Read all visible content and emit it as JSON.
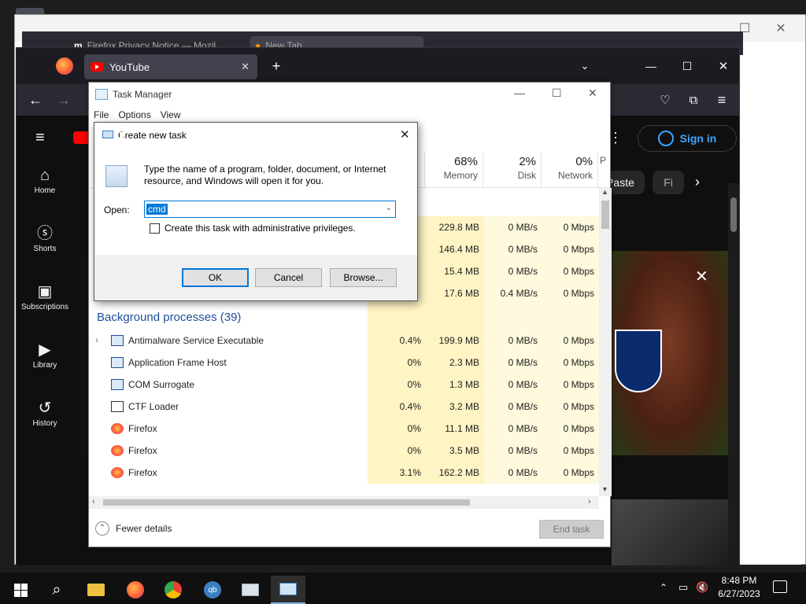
{
  "bg_firefox": {
    "tab1": "Firefox Privacy Notice — Mozil",
    "tab2": "New Tab"
  },
  "firefox": {
    "tab_title": "YouTube",
    "new_tab": "+",
    "menu": "≡"
  },
  "youtube": {
    "sidebar": [
      {
        "icon": "home-icon",
        "label": "Home"
      },
      {
        "icon": "shorts-icon",
        "label": "Shorts"
      },
      {
        "icon": "subscriptions-icon",
        "label": "Subscriptions"
      },
      {
        "icon": "library-icon",
        "label": "Library"
      },
      {
        "icon": "history-icon",
        "label": "History"
      }
    ],
    "sign_in": "Sign in",
    "chip1": "Paste",
    "chip2": "Fi",
    "close_ad": "✕"
  },
  "task_manager": {
    "title": "Task Manager",
    "menu": [
      "File",
      "Options",
      "View"
    ],
    "columns": [
      {
        "pct": "68%",
        "name": "Memory"
      },
      {
        "pct": "2%",
        "name": "Disk"
      },
      {
        "pct": "0%",
        "name": "Network"
      },
      {
        "pct": "",
        "name": "P"
      }
    ],
    "app_rows": [
      {
        "cpu": "",
        "mem": "229.8 MB",
        "disk": "0 MB/s",
        "net": "0 Mbps"
      },
      {
        "cpu": "",
        "mem": "146.4 MB",
        "disk": "0 MB/s",
        "net": "0 Mbps"
      },
      {
        "cpu": "",
        "mem": "15.4 MB",
        "disk": "0 MB/s",
        "net": "0 Mbps"
      },
      {
        "cpu": "",
        "mem": "17.6 MB",
        "disk": "0.4 MB/s",
        "net": "0 Mbps"
      }
    ],
    "bg_section": "Background processes (39)",
    "processes": [
      {
        "name": "Antimalware Service Executable",
        "cpu": "0.4%",
        "mem": "199.9 MB",
        "disk": "0 MB/s",
        "net": "0 Mbps",
        "expand": true
      },
      {
        "name": "Application Frame Host",
        "cpu": "0%",
        "mem": "2.3 MB",
        "disk": "0 MB/s",
        "net": "0 Mbps"
      },
      {
        "name": "COM Surrogate",
        "cpu": "0%",
        "mem": "1.3 MB",
        "disk": "0 MB/s",
        "net": "0 Mbps"
      },
      {
        "name": "CTF Loader",
        "cpu": "0.4%",
        "mem": "3.2 MB",
        "disk": "0 MB/s",
        "net": "0 Mbps"
      },
      {
        "name": "Firefox",
        "cpu": "0%",
        "mem": "11.1 MB",
        "disk": "0 MB/s",
        "net": "0 Mbps"
      },
      {
        "name": "Firefox",
        "cpu": "0%",
        "mem": "3.5 MB",
        "disk": "0 MB/s",
        "net": "0 Mbps"
      },
      {
        "name": "Firefox",
        "cpu": "3.1%",
        "mem": "162.2 MB",
        "disk": "0 MB/s",
        "net": "0 Mbps"
      }
    ],
    "fewer_details": "Fewer details",
    "end_task": "End task"
  },
  "run_dialog": {
    "title": "Create new task",
    "description": "Type the name of a program, folder, document, or Internet resource, and Windows will open it for you.",
    "open_label": "Open:",
    "open_value": "cmd",
    "admin_checkbox": "Create this task with administrative privileges.",
    "ok": "OK",
    "cancel": "Cancel",
    "browse": "Browse..."
  },
  "taskbar": {
    "time": "8:48 PM",
    "date": "6/27/2023",
    "apps": [
      "file-explorer-icon",
      "firefox-icon",
      "chrome-icon",
      "qbittorrent-icon",
      "task-manager-icon",
      "run-icon"
    ]
  }
}
